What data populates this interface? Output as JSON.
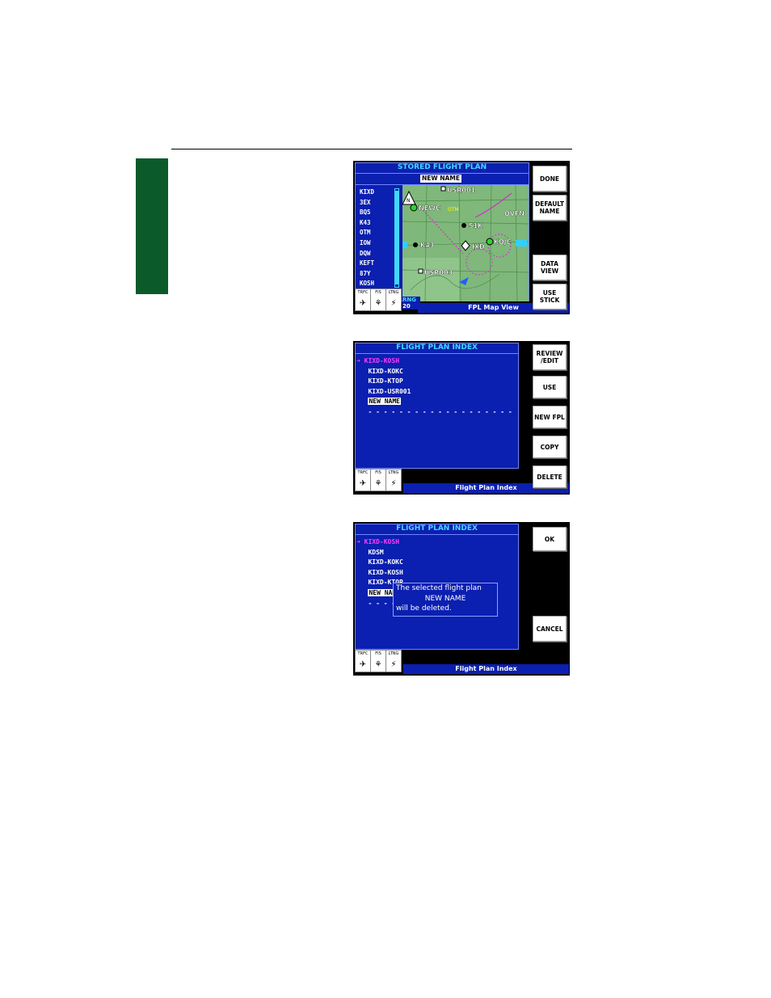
{
  "screen1": {
    "title": "STORED FLIGHT PLAN",
    "plan_name": "NEW NAME",
    "waypoints": [
      "KIXD",
      "3EX",
      "BQS",
      "K43",
      "OTM",
      "IOW",
      "DQW",
      "KEFT",
      "87Y",
      "KOSH"
    ],
    "map_labels": {
      "newc": "NEWC",
      "usr001": "USR001",
      "otm": "OTM",
      "usr003": "USR003",
      "k43": "K43",
      "ixd": "IXD",
      "kojc": "KOJC",
      "ovfn": "OVFN",
      "bqs": "51K",
      "n": "N"
    },
    "status_labels": [
      "TRFC",
      "FIS",
      "LTNG"
    ],
    "range_label": "RNG",
    "range_value": "20",
    "bottom_title": "FPL Map View",
    "buttons": [
      "DONE",
      "DEFAULT\nNAME",
      "DATA\nVIEW",
      "USE\nSTICK"
    ]
  },
  "screen2": {
    "title": "FLIGHT PLAN INDEX",
    "rows": [
      "KIXD-KOSH",
      "KIXD-KOKC",
      "KIXD-KTOP",
      "KIXD-USR001",
      "NEW NAME",
      "- - - - - - - - - - - - - - - - - - -"
    ],
    "selected_marker": "➜",
    "status_labels": [
      "TRFC",
      "FIS",
      "LTNG"
    ],
    "bottom_title": "Flight Plan Index",
    "buttons": [
      "REVIEW\n/EDIT",
      "USE",
      "NEW FPL",
      "COPY",
      "DELETE"
    ]
  },
  "screen3": {
    "title": "FLIGHT PLAN INDEX",
    "rows": [
      "KIXD-KOSH",
      "KDSM",
      "KIXD-KOKC",
      "KIXD-KOSH",
      "KIXD-KTOP",
      "NEW NAME",
      "- - - -"
    ],
    "selected_marker": "➜",
    "dialog": {
      "line1": "The selected flight plan",
      "line2": "NEW NAME",
      "line3": "will be deleted."
    },
    "status_labels": [
      "TRFC",
      "FIS",
      "LTNG"
    ],
    "bottom_title": "Flight Plan Index",
    "buttons": [
      "OK",
      "CANCEL"
    ]
  },
  "colors": {
    "panel": "#0b1fb0",
    "title_text": "#42d8ff",
    "selected_text": "#ff3cff",
    "tab_green": "#0a5a2a",
    "map_green": "#7fb87a"
  }
}
